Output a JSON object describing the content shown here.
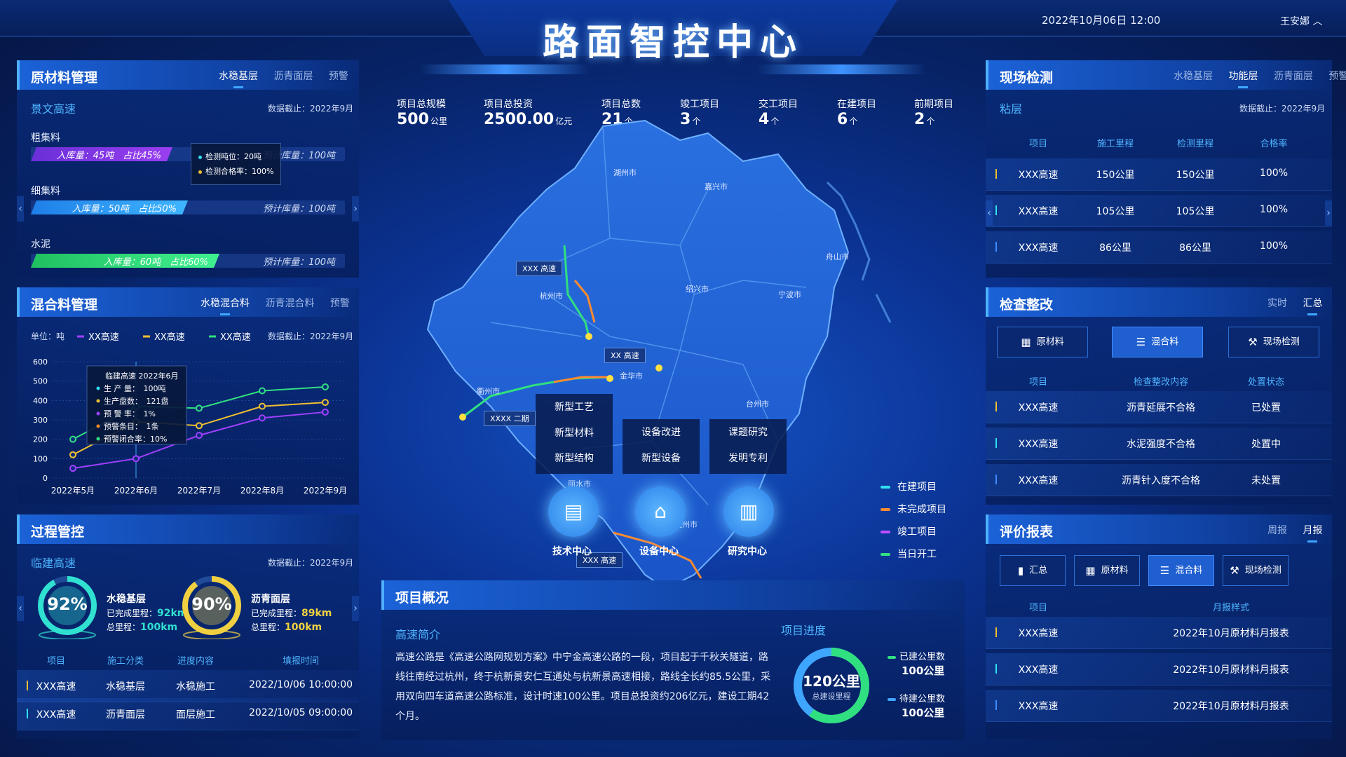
{
  "header": {
    "title": "路面智控中心",
    "datetime": "2022年10月06日 12:00",
    "user": "王安娜"
  },
  "stats": [
    {
      "label": "项目总规模",
      "value": "500",
      "unit": "公里"
    },
    {
      "label": "项目总投资",
      "value": "2500.00",
      "unit": "亿元"
    },
    {
      "label": "项目总数",
      "value": "21",
      "unit": "个"
    },
    {
      "label": "竣工项目",
      "value": "3",
      "unit": "个"
    },
    {
      "label": "交工项目",
      "value": "4",
      "unit": "个"
    },
    {
      "label": "在建项目",
      "value": "6",
      "unit": "个"
    },
    {
      "label": "前期项目",
      "value": "2",
      "unit": "个"
    }
  ],
  "raw": {
    "title": "原材料管理",
    "tabs": [
      "水稳基层",
      "沥青面层",
      "预警"
    ],
    "sub": "景文高速",
    "cutoff": "数据截止：2022年9月",
    "items": [
      {
        "name": "粗集料",
        "fill": "入库量：45吨　占比45%",
        "plan": "预计库量：100吨",
        "ratio": 0.45
      },
      {
        "name": "细集料",
        "fill": "入库量：50吨　占比50%",
        "plan": "预计库量：100吨",
        "ratio": 0.5
      },
      {
        "name": "水泥",
        "fill": "入库量：60吨　占比60%",
        "plan": "预计库量：100吨",
        "ratio": 0.6
      }
    ],
    "tip": [
      "检测吨位：20吨",
      "检测合格率：100%"
    ]
  },
  "mix": {
    "title": "混合料管理",
    "tabs": [
      "水稳混合料",
      "沥青混合料",
      "预警"
    ],
    "unit": "单位：吨",
    "cutoff": "数据截止：2022年9月",
    "tip": {
      "title": "临建高速 2022年6月",
      "rows": [
        "生 产 量：　100吨",
        "生产盘数：　121盘",
        "预 警 率：　1%",
        "预警条目：　1条",
        "预警闭合率：10%"
      ]
    }
  },
  "chart_data": {
    "type": "line",
    "categories": [
      "2022年5月",
      "2022年6月",
      "2022年7月",
      "2022年8月",
      "2022年9月"
    ],
    "ylim": [
      0,
      600
    ],
    "yticks": [
      0,
      100,
      200,
      300,
      400,
      500,
      600
    ],
    "series": [
      {
        "name": "XX高速",
        "color": "#a040ff",
        "values": [
          50,
          100,
          220,
          310,
          340
        ]
      },
      {
        "name": "XX高速",
        "color": "#f0c030",
        "values": [
          120,
          290,
          270,
          370,
          390
        ]
      },
      {
        "name": "XX高速",
        "color": "#30e080",
        "values": [
          200,
          370,
          360,
          450,
          470
        ]
      }
    ]
  },
  "process": {
    "title": "过程管控",
    "sub": "临建高速",
    "cutoff": "数据截止：2022年9月",
    "gauges": [
      {
        "pct": "92%",
        "value": 0.92,
        "name": "水稳基层",
        "done": "已完成里程：",
        "done_v": "92km",
        "total": "总里程：",
        "total_v": "100km"
      },
      {
        "pct": "90%",
        "value": 0.9,
        "name": "沥青面层",
        "done": "已完成里程：",
        "done_v": "89km",
        "total": "总里程：",
        "total_v": "100km"
      }
    ],
    "headers": [
      "项目",
      "施工分类",
      "进度内容",
      "填报时间"
    ],
    "rows": [
      [
        "XXX高速",
        "水稳基层",
        "水稳施工",
        "2022/10/06 10:00:00"
      ],
      [
        "XXX高速",
        "沥青面层",
        "面层施工",
        "2022/10/05 09:00:00"
      ]
    ]
  },
  "map": {
    "cities": [
      "湖州市",
      "嘉兴市",
      "杭州市",
      "绍兴市",
      "宁波市",
      "舟山市",
      "金华市",
      "衢州市",
      "台州市",
      "丽水市",
      "温州市"
    ],
    "roads": [
      "XXX 高速",
      "XX 高速",
      "XXXX 二期",
      "XXX 高速",
      "XXX 高速"
    ],
    "boxes": {
      "a": [
        "新型工艺",
        "新型材料",
        "新型结构"
      ],
      "b": [
        "设备改进",
        "新型设备"
      ],
      "c": [
        "课题研究",
        "发明专利"
      ]
    },
    "centers": [
      "技术中心",
      "设备中心",
      "研究中心"
    ],
    "legend": [
      {
        "label": "在建项目",
        "color": "#30e0f0"
      },
      {
        "label": "未完成项目",
        "color": "#ff8a30"
      },
      {
        "label": "竣工项目",
        "color": "#c050ff"
      },
      {
        "label": "当日开工",
        "color": "#30e080"
      }
    ]
  },
  "overview": {
    "title": "项目概况",
    "intro_title": "高速简介",
    "intro": "高速公路是《高速公路网规划方案》中宁金高速公路的一段，项目起于千秋关隧道，路线往南经过杭州，终于杭新景安仁互通处与杭新景高速相接，路线全长约85.5公里，采用双向四车道高速公路标准，设计时速100公里。项目总投资约206亿元，建设工期42个月。",
    "progress_title": "项目进度",
    "ring_value": "120公里",
    "ring_label": "总建设里程",
    "ring_built": 0.6,
    "built_label": "已建公里数",
    "built_value": "100公里",
    "pending_label": "待建公里数",
    "pending_value": "100公里"
  },
  "field": {
    "title": "现场检测",
    "tabs": [
      "水稳基层",
      "功能层",
      "沥青面层",
      "预警"
    ],
    "sub": "粘层",
    "cutoff": "数据截止：2022年9月",
    "headers": [
      "项目",
      "施工里程",
      "检测里程",
      "合格率"
    ],
    "rows": [
      [
        "XXX高速",
        "150公里",
        "150公里",
        "100%"
      ],
      [
        "XXX高速",
        "105公里",
        "105公里",
        "100%"
      ],
      [
        "XXX高速",
        "86公里",
        "86公里",
        "100%"
      ]
    ]
  },
  "inspect": {
    "title": "检查整改",
    "tabs": [
      "实时",
      "汇总"
    ],
    "buttons": [
      "原材料",
      "混合料",
      "现场检测"
    ],
    "headers": [
      "项目",
      "检查整改内容",
      "处置状态"
    ],
    "rows": [
      [
        "XXX高速",
        "沥青延展不合格",
        "已处置"
      ],
      [
        "XXX高速",
        "水泥强度不合格",
        "处置中"
      ],
      [
        "XXX高速",
        "沥青针入度不合格",
        "未处置"
      ]
    ]
  },
  "report": {
    "title": "评价报表",
    "tabs": [
      "周报",
      "月报"
    ],
    "buttons": [
      "汇总",
      "原材料",
      "混合料",
      "现场检测"
    ],
    "headers": [
      "项目",
      "月报样式"
    ],
    "rows": [
      [
        "XXX高速",
        "2022年10月原材料月报表"
      ],
      [
        "XXX高速",
        "2022年10月原材料月报表"
      ],
      [
        "XXX高速",
        "2022年10月原材料月报表"
      ]
    ]
  }
}
